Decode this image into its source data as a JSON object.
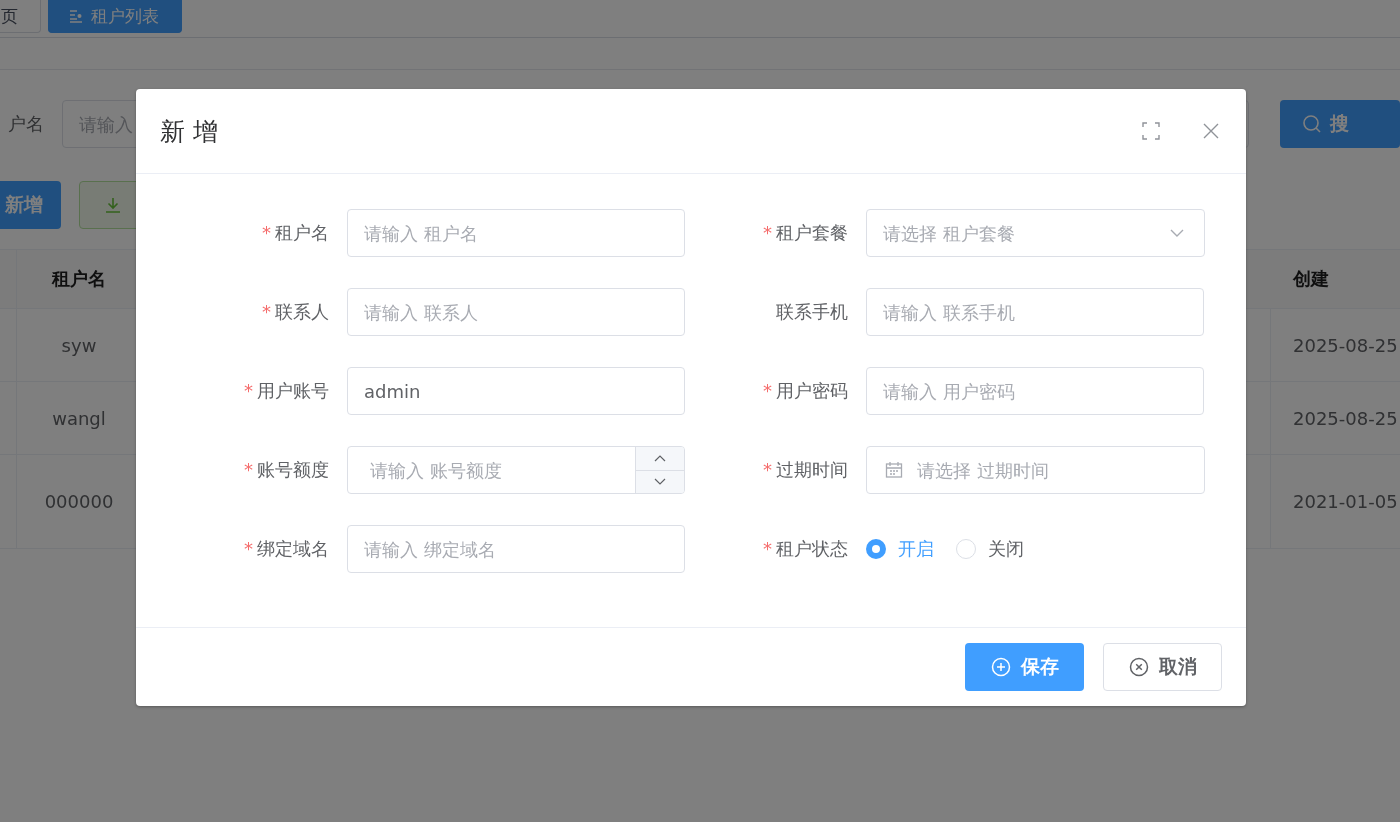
{
  "tabs": [
    {
      "label": "页",
      "selected": false
    },
    {
      "label": "租户列表",
      "selected": true
    }
  ],
  "search": {
    "label": "户名",
    "placeholder": "请输入",
    "button": "搜"
  },
  "toolbar": {
    "add_button": "新增"
  },
  "table": {
    "columns": [
      "租户名",
      "创建"
    ],
    "rows": [
      {
        "name": "syw",
        "created": "2025-08-25"
      },
      {
        "name": "wangl",
        "created": "2025-08-25"
      },
      {
        "name": "000000",
        "created": "2021-01-05"
      }
    ]
  },
  "dialog": {
    "title": "新 增",
    "required_mark": "*",
    "fields": [
      {
        "label": "租户名",
        "required": true,
        "kind": "text",
        "placeholder": "请输入 租户名"
      },
      {
        "label": "租户套餐",
        "required": true,
        "kind": "select",
        "placeholder": "请选择 租户套餐"
      },
      {
        "label": "联系人",
        "required": true,
        "kind": "text",
        "placeholder": "请输入 联系人"
      },
      {
        "label": "联系手机",
        "required": false,
        "kind": "text",
        "placeholder": "请输入 联系手机"
      },
      {
        "label": "用户账号",
        "required": true,
        "kind": "text",
        "value": "admin"
      },
      {
        "label": "用户密码",
        "required": true,
        "kind": "text",
        "placeholder": "请输入 用户密码"
      },
      {
        "label": "账号额度",
        "required": true,
        "kind": "number",
        "placeholder": "请输入 账号额度"
      },
      {
        "label": "过期时间",
        "required": true,
        "kind": "date",
        "placeholder": "请选择 过期时间"
      },
      {
        "label": "绑定域名",
        "required": true,
        "kind": "text",
        "placeholder": "请输入 绑定域名"
      },
      {
        "label": "租户状态",
        "required": true,
        "kind": "radio",
        "options": [
          {
            "label": "开启",
            "selected": true
          },
          {
            "label": "关闭",
            "selected": false
          }
        ]
      }
    ],
    "buttons": [
      {
        "label": "保存",
        "kind": "primary"
      },
      {
        "label": "取消",
        "kind": "default"
      }
    ]
  }
}
